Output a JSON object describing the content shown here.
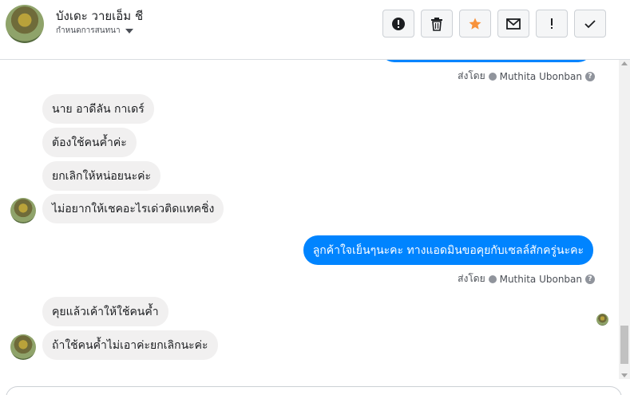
{
  "header": {
    "contact_name": "บังเดะ วายเอ็ม ชี",
    "settings_label": "กำหนดการสนทนา",
    "toolbar": [
      {
        "icon": "spam-alert-icon"
      },
      {
        "icon": "trash-icon"
      },
      {
        "icon": "star-icon",
        "color": "#f7923b"
      },
      {
        "icon": "mail-icon"
      },
      {
        "icon": "exclamation-icon"
      },
      {
        "icon": "checkmark-icon"
      }
    ]
  },
  "messages": {
    "sent_by_1": {
      "prefix": "ส่งโดย",
      "name": "Muthita Ubonban"
    },
    "incoming_group_1": [
      "นาย อาดีลัน กาเดร์",
      "ต้องใช้คนค้ำค่ะ",
      "ยกเลิกให้หน่อยนะค่ะ",
      "ไม่อยากให้เชคอะไรเด่วติดแทคชิ่ง"
    ],
    "outgoing_1": "ลูกค้าใจเย็นๆนะคะ ทางแอดมินขอคุยกับเซลล์สักครู่นะคะ",
    "sent_by_2": {
      "prefix": "ส่งโดย",
      "name": "Muthita Ubonban"
    },
    "incoming_group_2": [
      "คุยแล้วเค้าให้ใช้คนค้ำ",
      "ถ้าใช้คนค้ำไม่เอาค่ะยกเลิกนะค่ะ"
    ]
  },
  "colors": {
    "outgoing_bubble": "#0084ff",
    "incoming_bubble": "#f1f0f0"
  }
}
